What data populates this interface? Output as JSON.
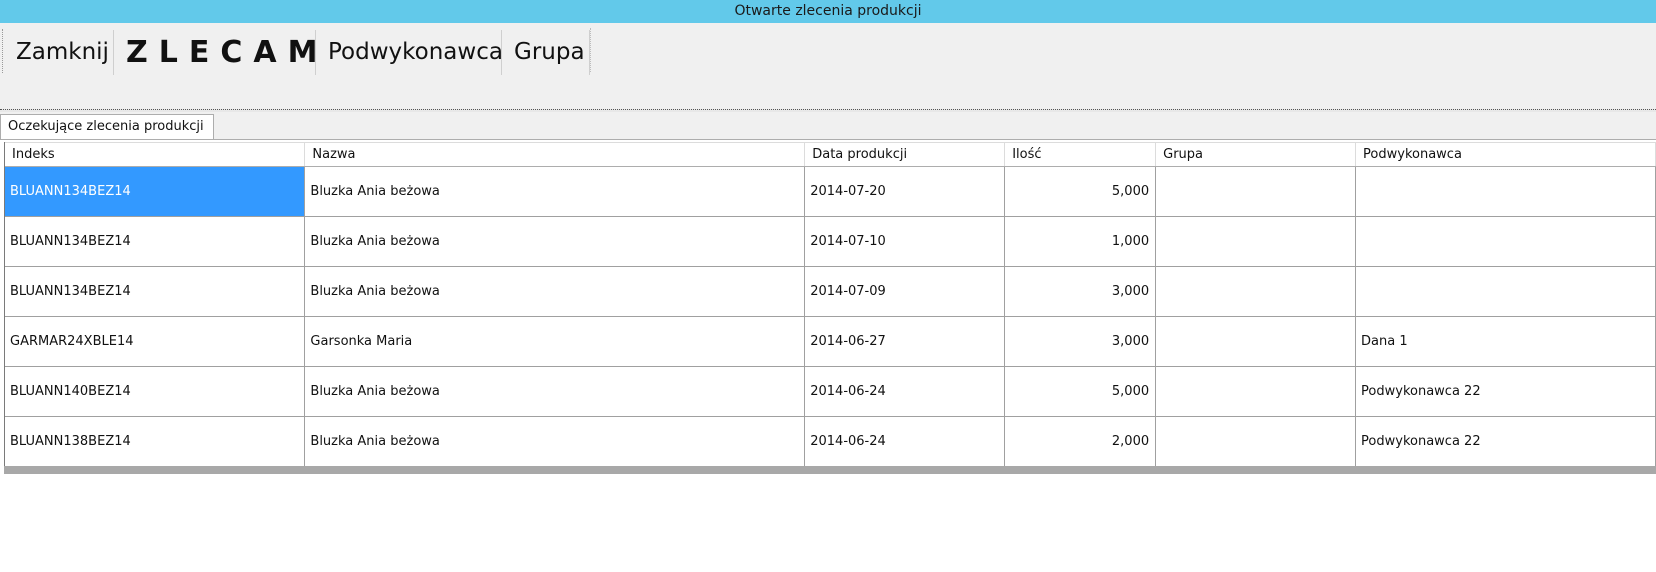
{
  "window": {
    "title": "Otwarte zlecenia produkcji"
  },
  "toolbar": {
    "close_label": "Zamknij",
    "order_label": "ZLECAM",
    "subcontractor_label": "Podwykonawca",
    "group_label": "Grupa"
  },
  "tabs": [
    {
      "label": "Oczekujące zlecenia produkcji"
    }
  ],
  "table": {
    "columns": [
      "Indeks",
      "Nazwa",
      "Data produkcji",
      "Ilość",
      "Grupa",
      "Podwykonawca"
    ],
    "rows": [
      [
        "BLUANN134BEZ14",
        "Bluzka Ania beżowa",
        "2014-07-20",
        "5,000",
        "",
        ""
      ],
      [
        "BLUANN134BEZ14",
        "Bluzka Ania beżowa",
        "2014-07-10",
        "1,000",
        "",
        ""
      ],
      [
        "BLUANN134BEZ14",
        "Bluzka Ania beżowa",
        "2014-07-09",
        "3,000",
        "",
        ""
      ],
      [
        "GARMAR24XBLE14",
        "Garsonka Maria",
        "2014-06-27",
        "3,000",
        "",
        "Dana 1"
      ],
      [
        "BLUANN140BEZ14",
        "Bluzka Ania beżowa",
        "2014-06-24",
        "5,000",
        "",
        "Podwykonawca 22"
      ],
      [
        "BLUANN138BEZ14",
        "Bluzka Ania beżowa",
        "2014-06-24",
        "2,000",
        "",
        "Podwykonawca 22"
      ]
    ],
    "selected_cell": {
      "row": 0,
      "col": 0
    }
  },
  "colors": {
    "titlebar": "#62c9ea",
    "selection": "#3399ff",
    "toolbar_bg": "#f0f0f0"
  }
}
